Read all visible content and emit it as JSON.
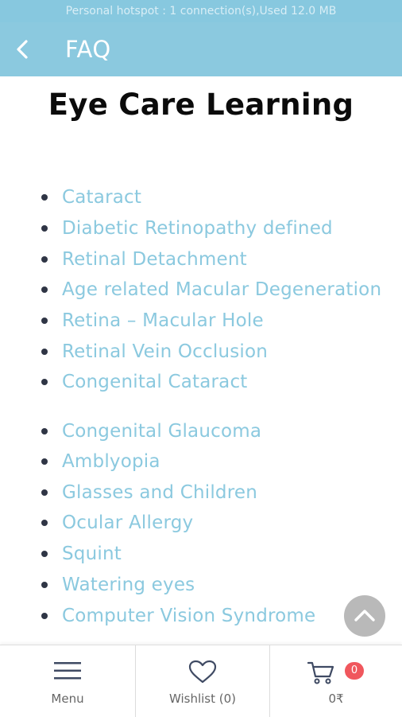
{
  "status_bar": {
    "text": "Personal hotspot : 1 connection(s),Used  12.0 MB"
  },
  "app_bar": {
    "title": "FAQ",
    "back_icon": "chevron-left-icon",
    "background": "#8bc9df"
  },
  "page": {
    "title": "Eye Care Learning"
  },
  "topics": [
    "Cataract",
    "Diabetic Retinopathy defined",
    "Retinal Detachment",
    "Age related Macular Degeneration",
    "Retina – Macular Hole",
    "Retinal Vein Occlusion",
    "Congenital Cataract",
    "Congenital Glaucoma",
    "Amblyopia",
    "Glasses and Children",
    "Ocular Allergy",
    "Squint",
    "Watering eyes",
    "Computer Vision Syndrome"
  ],
  "link_color": "#8bc9df",
  "scroll_top": {
    "icon": "chevron-up-icon"
  },
  "bottom_nav": {
    "menu": {
      "label": "Menu",
      "icon": "hamburger-icon"
    },
    "wishlist": {
      "label": "Wishlist (0)",
      "icon": "heart-icon"
    },
    "cart": {
      "label": "0₹",
      "icon": "cart-icon",
      "badge": "0",
      "badge_color": "#f0575d"
    }
  }
}
